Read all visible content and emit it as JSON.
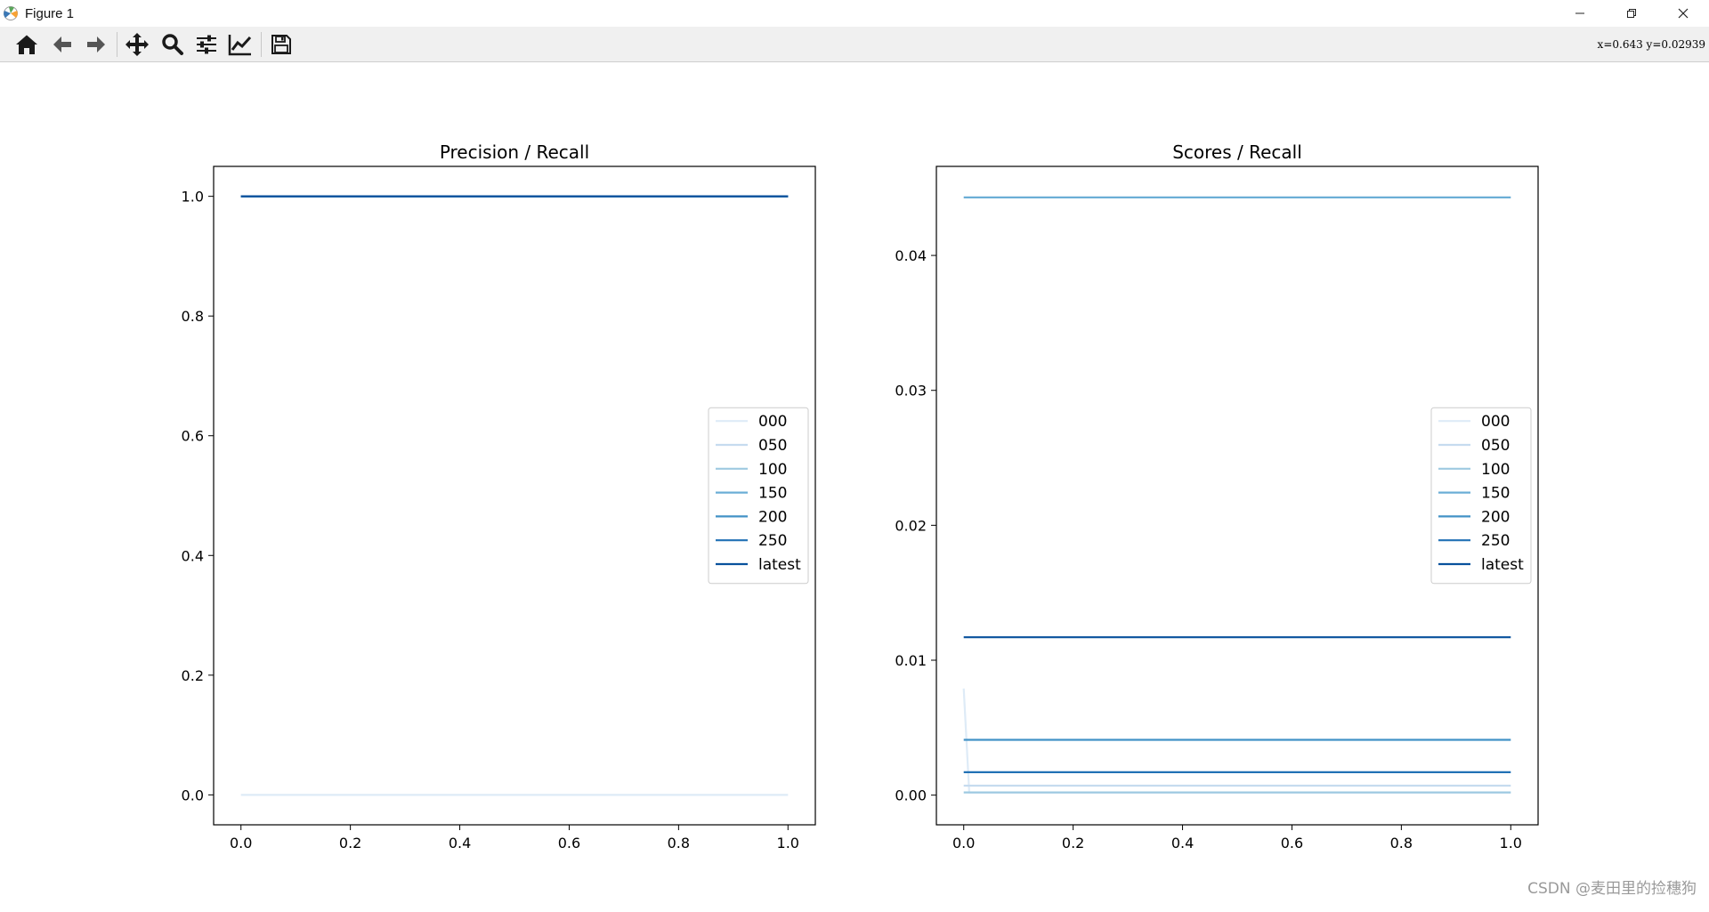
{
  "window": {
    "title": "Figure 1",
    "controls": [
      "minimize-icon",
      "restore-icon",
      "close-icon"
    ]
  },
  "toolbar": {
    "buttons": [
      {
        "name": "home",
        "icon": "home-icon"
      },
      {
        "name": "back",
        "icon": "arrow-left-icon"
      },
      {
        "name": "forward",
        "icon": "arrow-right-icon"
      },
      {
        "name": "pan",
        "icon": "move-icon"
      },
      {
        "name": "zoom",
        "icon": "magnifier-icon"
      },
      {
        "name": "subplots",
        "icon": "sliders-icon"
      },
      {
        "name": "edit-axis",
        "icon": "line-chart-icon"
      },
      {
        "name": "save",
        "icon": "floppy-disk-icon"
      }
    ],
    "coord_readout": "x=0.643 y=0.02939"
  },
  "watermark": "CSDN @麦田里的捡穗狗",
  "colors": {
    "000": "#deebf7",
    "050": "#c6dbef",
    "100": "#9ecae1",
    "150": "#6baed6",
    "200": "#4292c6",
    "250": "#2171b5",
    "latest": "#08519c"
  },
  "chart_data": [
    {
      "type": "line",
      "title": "Precision / Recall",
      "xlabel": "",
      "ylabel": "",
      "xlim": [
        -0.05,
        1.05
      ],
      "ylim": [
        -0.05,
        1.05
      ],
      "xticks": [
        "0.0",
        "0.2",
        "0.4",
        "0.6",
        "0.8",
        "1.0"
      ],
      "yticks": [
        "0.0",
        "0.2",
        "0.4",
        "0.6",
        "0.8",
        "1.0"
      ],
      "xtick_values": [
        0,
        0.2,
        0.4,
        0.6,
        0.8,
        1.0
      ],
      "ytick_values": [
        0,
        0.2,
        0.4,
        0.6,
        0.8,
        1.0
      ],
      "grid": false,
      "legend": "center right",
      "series": [
        {
          "name": "000",
          "x": [
            0,
            1
          ],
          "y": [
            0,
            0
          ]
        },
        {
          "name": "050",
          "x": [
            0,
            1
          ],
          "y": [
            1,
            1
          ]
        },
        {
          "name": "100",
          "x": [
            0,
            1
          ],
          "y": [
            1,
            1
          ]
        },
        {
          "name": "150",
          "x": [
            0,
            1
          ],
          "y": [
            1,
            1
          ]
        },
        {
          "name": "200",
          "x": [
            0,
            1
          ],
          "y": [
            1,
            1
          ]
        },
        {
          "name": "250",
          "x": [
            0,
            1
          ],
          "y": [
            1,
            1
          ]
        },
        {
          "name": "latest",
          "x": [
            0,
            1
          ],
          "y": [
            1,
            1
          ]
        }
      ]
    },
    {
      "type": "line",
      "title": "Scores / Recall",
      "xlabel": "",
      "ylabel": "",
      "xlim": [
        -0.05,
        1.05
      ],
      "ylim": [
        -0.0022,
        0.0466
      ],
      "xticks": [
        "0.0",
        "0.2",
        "0.4",
        "0.6",
        "0.8",
        "1.0"
      ],
      "yticks": [
        "0.00",
        "0.01",
        "0.02",
        "0.03",
        "0.04"
      ],
      "xtick_values": [
        0,
        0.2,
        0.4,
        0.6,
        0.8,
        1.0
      ],
      "ytick_values": [
        0,
        0.01,
        0.02,
        0.03,
        0.04
      ],
      "grid": false,
      "legend": "center right",
      "series": [
        {
          "name": "000",
          "x": [
            0,
            0.01,
            1
          ],
          "y": [
            0.0079,
            0.0002,
            0.0002
          ]
        },
        {
          "name": "050",
          "x": [
            0,
            1
          ],
          "y": [
            0.0007,
            0.0007
          ]
        },
        {
          "name": "100",
          "x": [
            0,
            1
          ],
          "y": [
            0.0002,
            0.0002
          ]
        },
        {
          "name": "150",
          "x": [
            0,
            1
          ],
          "y": [
            0.0443,
            0.0443
          ]
        },
        {
          "name": "200",
          "x": [
            0,
            1
          ],
          "y": [
            0.0041,
            0.0041
          ]
        },
        {
          "name": "250",
          "x": [
            0,
            1
          ],
          "y": [
            0.0017,
            0.0017
          ]
        },
        {
          "name": "latest",
          "x": [
            0,
            1
          ],
          "y": [
            0.0117,
            0.0117
          ]
        }
      ]
    }
  ]
}
